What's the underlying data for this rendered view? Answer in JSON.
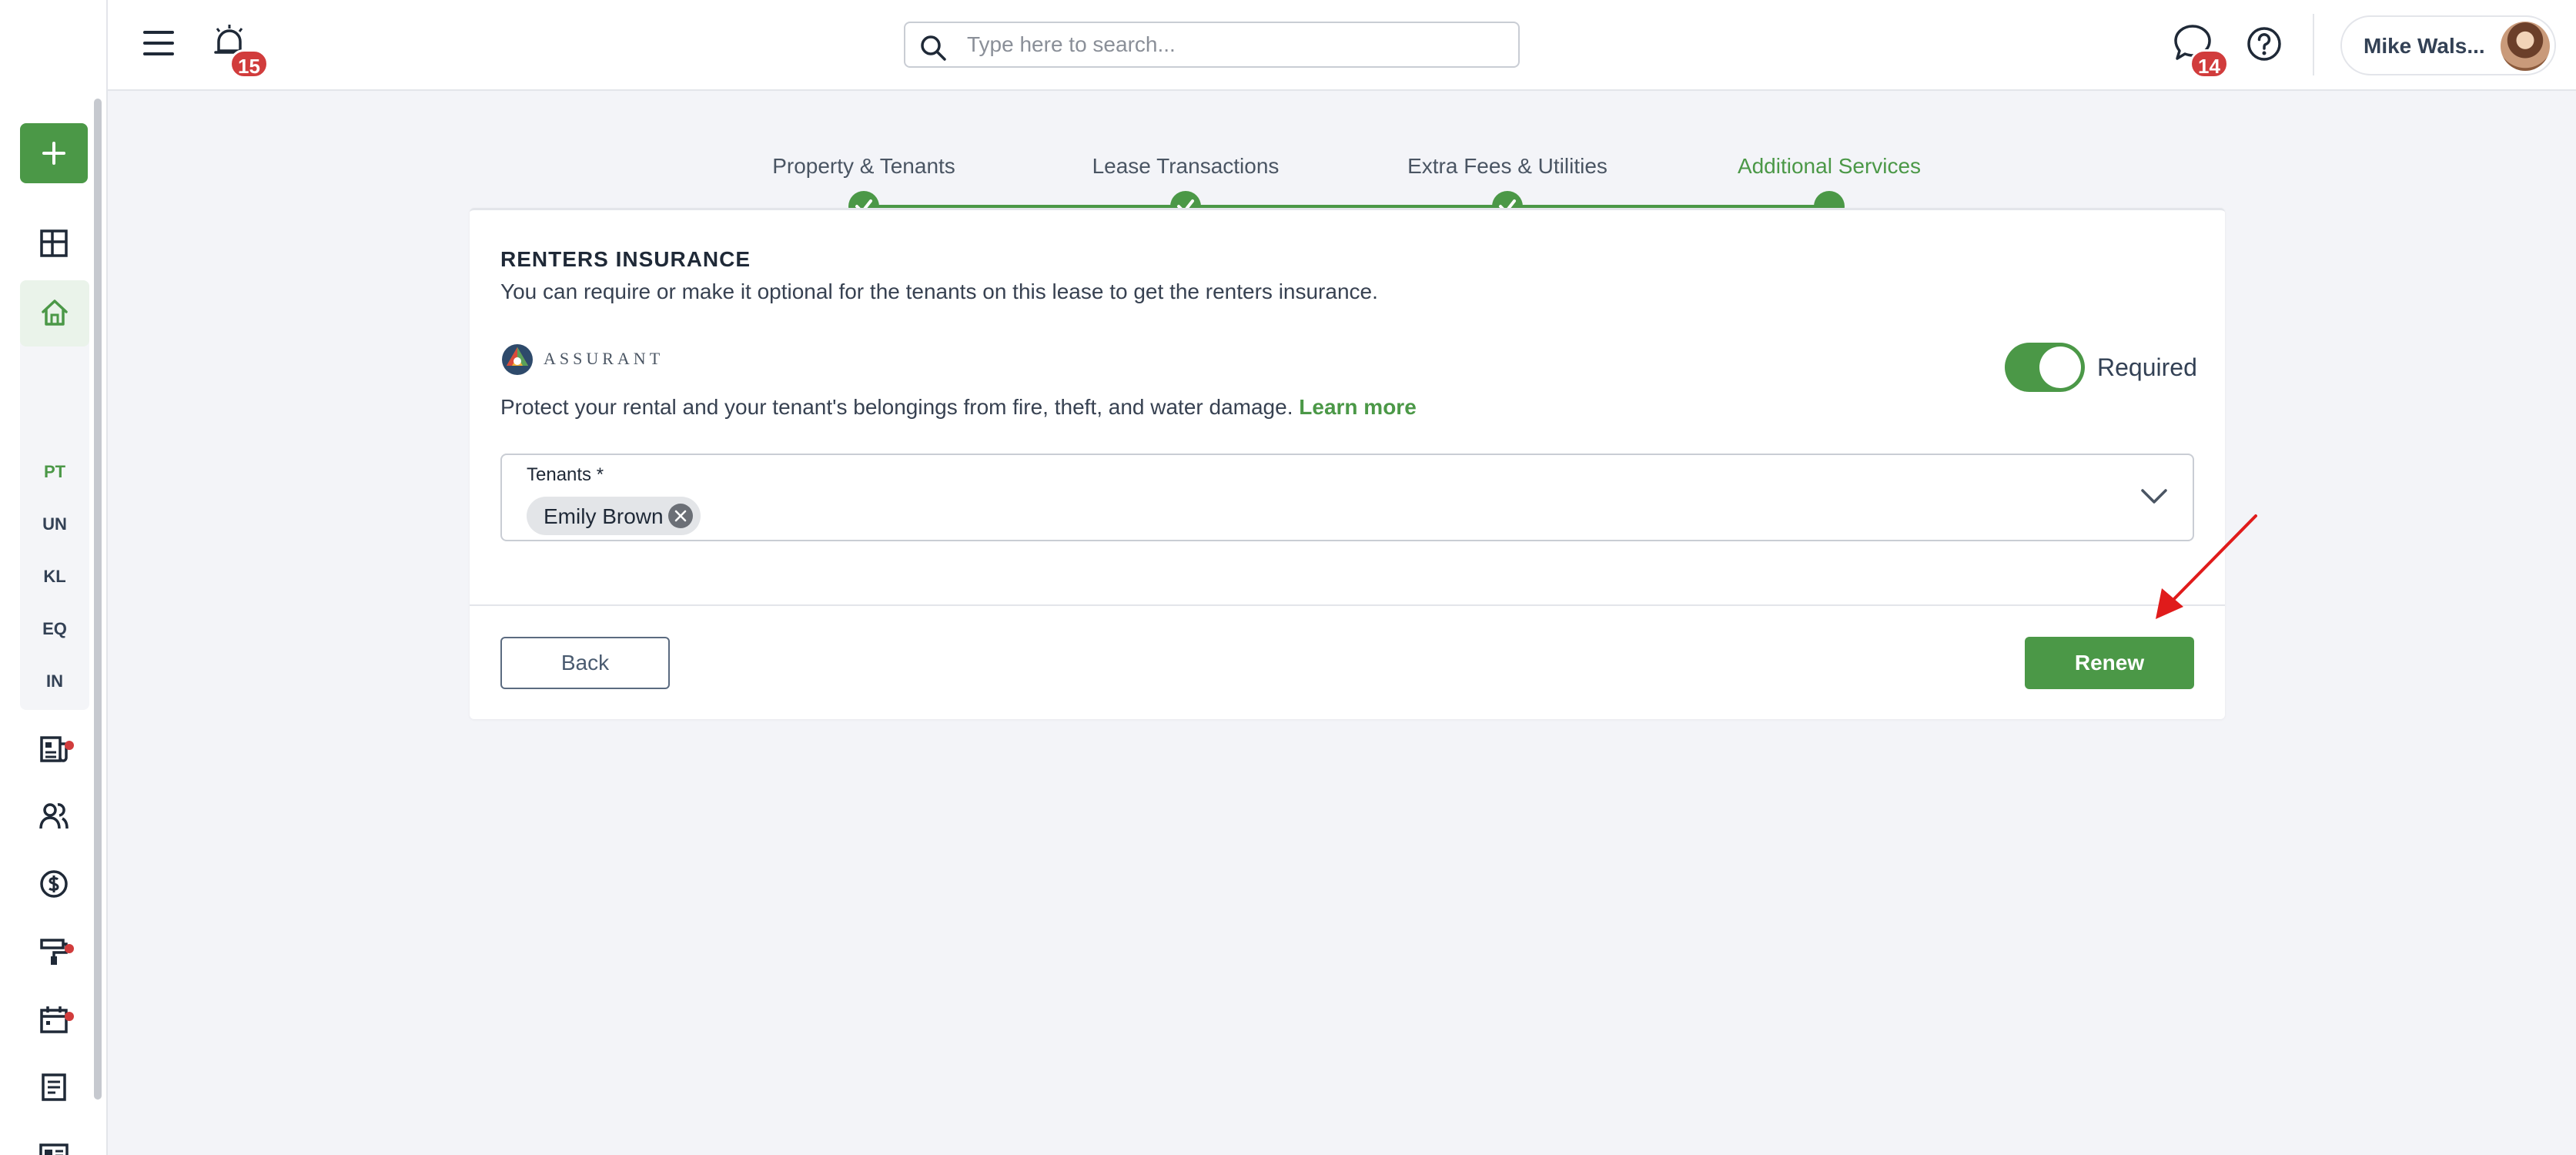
{
  "topbar": {
    "notifications_count": "15",
    "search_placeholder": "Type here to search...",
    "messages_count": "14",
    "user_name": "Mike Wals..."
  },
  "sidebar": {
    "shortcuts": [
      "PT",
      "UN",
      "KL",
      "EQ",
      "IN"
    ]
  },
  "stepper": {
    "steps": [
      {
        "label": "Property & Tenants",
        "status": "complete"
      },
      {
        "label": "Lease Transactions",
        "status": "complete"
      },
      {
        "label": "Extra Fees & Utilities",
        "status": "complete"
      },
      {
        "label": "Additional Services",
        "status": "active"
      }
    ]
  },
  "renters_insurance": {
    "title": "RENTERS INSURANCE",
    "description": "You can require or make it optional for the tenants on this lease to get the renters insurance.",
    "provider_name": "ASSURANT",
    "toggle_label": "Required",
    "toggle_on": true,
    "protect_text": "Protect your rental and your tenant's belongings from fire, theft, and water damage.",
    "learn_more": "Learn more",
    "tenants_label": "Tenants *",
    "selected_tenants": [
      "Emily Brown"
    ]
  },
  "actions": {
    "back_label": "Back",
    "renew_label": "Renew"
  },
  "colors": {
    "accent_green": "#4b9847",
    "badge_red": "#d13c3c",
    "annotation_red": "#e01b1b"
  }
}
